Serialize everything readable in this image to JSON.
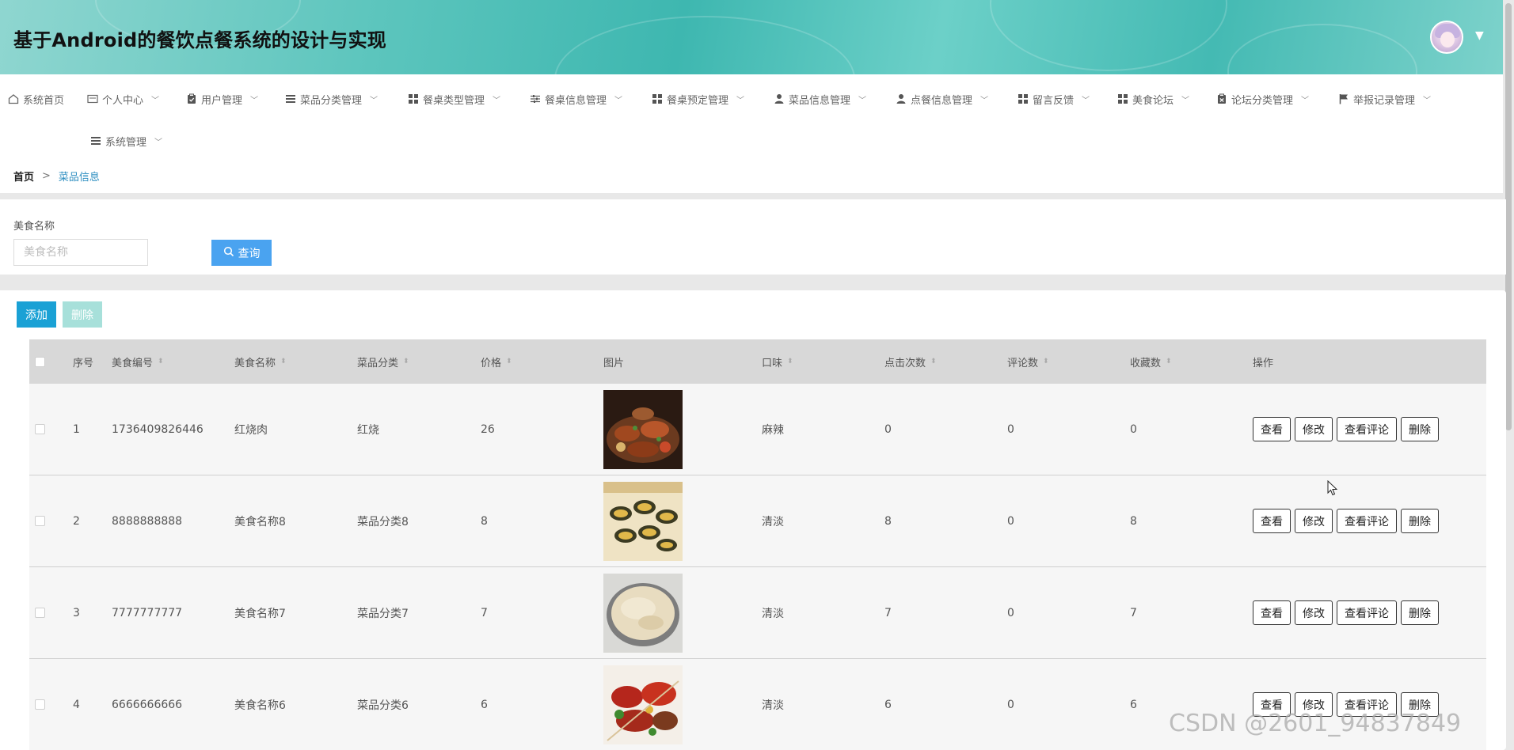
{
  "header": {
    "title": "基于Android的餐饮点餐系统的设计与实现",
    "avatar_icon": "avatar-icon",
    "caret_icon": "caret-down-icon"
  },
  "nav": {
    "items": [
      {
        "label": "系统首页",
        "icon": "home-icon"
      },
      {
        "label": "个人中心",
        "icon": "id-card-icon"
      },
      {
        "label": "用户管理",
        "icon": "clipboard-icon"
      },
      {
        "label": "菜品分类管理",
        "icon": "list-icon"
      },
      {
        "label": "餐桌类型管理",
        "icon": "grid-icon"
      },
      {
        "label": "餐桌信息管理",
        "icon": "sliders-icon"
      },
      {
        "label": "餐桌预定管理",
        "icon": "grid-icon"
      },
      {
        "label": "菜品信息管理",
        "icon": "user-icon"
      },
      {
        "label": "点餐信息管理",
        "icon": "user-icon"
      },
      {
        "label": "留言反馈",
        "icon": "grid-icon"
      },
      {
        "label": "美食论坛",
        "icon": "grid-icon"
      },
      {
        "label": "论坛分类管理",
        "icon": "clipboard-icon"
      },
      {
        "label": "举报记录管理",
        "icon": "flag-icon"
      },
      {
        "label": "系统管理",
        "icon": "list-icon"
      }
    ]
  },
  "breadcrumb": {
    "home": "首页",
    "separator": ">",
    "current": "菜品信息"
  },
  "search": {
    "label": "美食名称",
    "placeholder": "美食名称",
    "value": "",
    "button_label": "查询"
  },
  "toolbar": {
    "add_label": "添加",
    "delete_label": "删除"
  },
  "table": {
    "columns": [
      "序号",
      "美食编号",
      "美食名称",
      "菜品分类",
      "价格",
      "图片",
      "口味",
      "点击次数",
      "评论数",
      "收藏数",
      "操作"
    ],
    "actions": [
      "查看",
      "修改",
      "查看评论",
      "删除"
    ],
    "rows": [
      {
        "index": "1",
        "code": "1736409826446",
        "name": "红烧肉",
        "category": "红烧",
        "price": "26",
        "image": "dish-photo-platter",
        "taste": "麻辣",
        "clicks": "0",
        "comments": "0",
        "favorites": "0"
      },
      {
        "index": "2",
        "code": "8888888888",
        "name": "美食名称8",
        "category": "菜品分类8",
        "price": "8",
        "image": "dish-photo-scallops",
        "taste": "清淡",
        "clicks": "8",
        "comments": "0",
        "favorites": "8"
      },
      {
        "index": "3",
        "code": "7777777777",
        "name": "美食名称7",
        "category": "菜品分类7",
        "price": "7",
        "image": "dish-photo-rice",
        "taste": "清淡",
        "clicks": "7",
        "comments": "0",
        "favorites": "7"
      },
      {
        "index": "4",
        "code": "6666666666",
        "name": "美食名称6",
        "category": "菜品分类6",
        "price": "6",
        "image": "dish-photo-skewers",
        "taste": "清淡",
        "clicks": "6",
        "comments": "0",
        "favorites": "6"
      }
    ]
  },
  "colors": {
    "header_teal": "#3eb7b0",
    "search_button": "#4aa3f0",
    "add_button": "#1aa1d5",
    "delete_button_disabled": "#a7e0da",
    "breadcrumb_link": "#2f8fc1"
  },
  "watermark": "CSDN @2601_94837849"
}
